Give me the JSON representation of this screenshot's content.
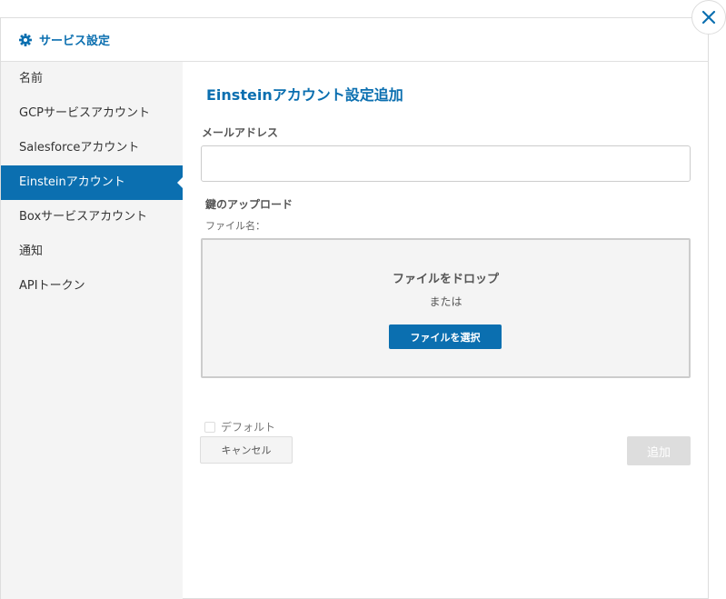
{
  "header": {
    "title": "サービス設定",
    "icon": "gear-icon",
    "accent_color": "#0b6fb0"
  },
  "close_icon": "close-icon",
  "sidebar": {
    "items": [
      {
        "label": "名前",
        "active": false
      },
      {
        "label": "GCPサービスアカウント",
        "active": false
      },
      {
        "label": "Salesforceアカウント",
        "active": false
      },
      {
        "label": "Einsteinアカウント",
        "active": true
      },
      {
        "label": "Boxサービスアカウント",
        "active": false
      },
      {
        "label": "通知",
        "active": false
      },
      {
        "label": "APIトークン",
        "active": false
      }
    ]
  },
  "form": {
    "title": "Einsteinアカウント設定追加",
    "email_label": "メールアドレス",
    "email_value": "",
    "key_upload_label": "鍵のアップロード",
    "filename_label": "ファイル名：",
    "drop_title": "ファイルをドロップ",
    "drop_or": "または",
    "select_file_label": "ファイルを選択",
    "default_label": "デフォルト",
    "default_checked": false,
    "cancel_label": "キャンセル",
    "add_label": "追加"
  }
}
